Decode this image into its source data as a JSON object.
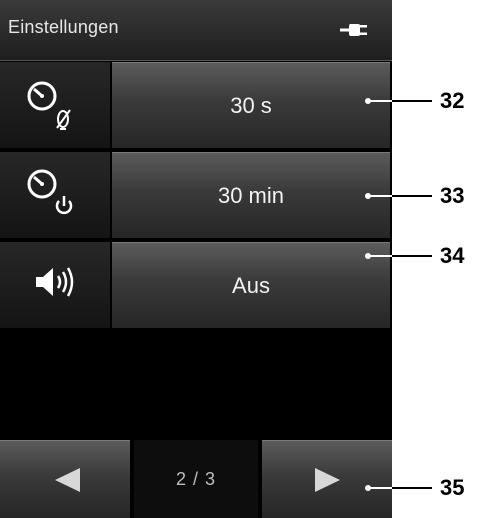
{
  "header": {
    "title": "Einstellungen",
    "power_icon": "plug-icon"
  },
  "settings": [
    {
      "icon": "timer-display-off-icon",
      "value": "30 s",
      "callout": "32"
    },
    {
      "icon": "timer-power-off-icon",
      "value": "30 min",
      "callout": "33"
    },
    {
      "icon": "speaker-icon",
      "value": "Aus",
      "callout": "34"
    }
  ],
  "nav": {
    "prev_icon": "triangle-left-icon",
    "page": "2 / 3",
    "next_icon": "triangle-right-icon",
    "callout": "35"
  },
  "colors": {
    "screen_bg": "#000000",
    "button_top": "#5b5b5b",
    "button_bottom": "#262626",
    "text": "#f2f2f2"
  }
}
